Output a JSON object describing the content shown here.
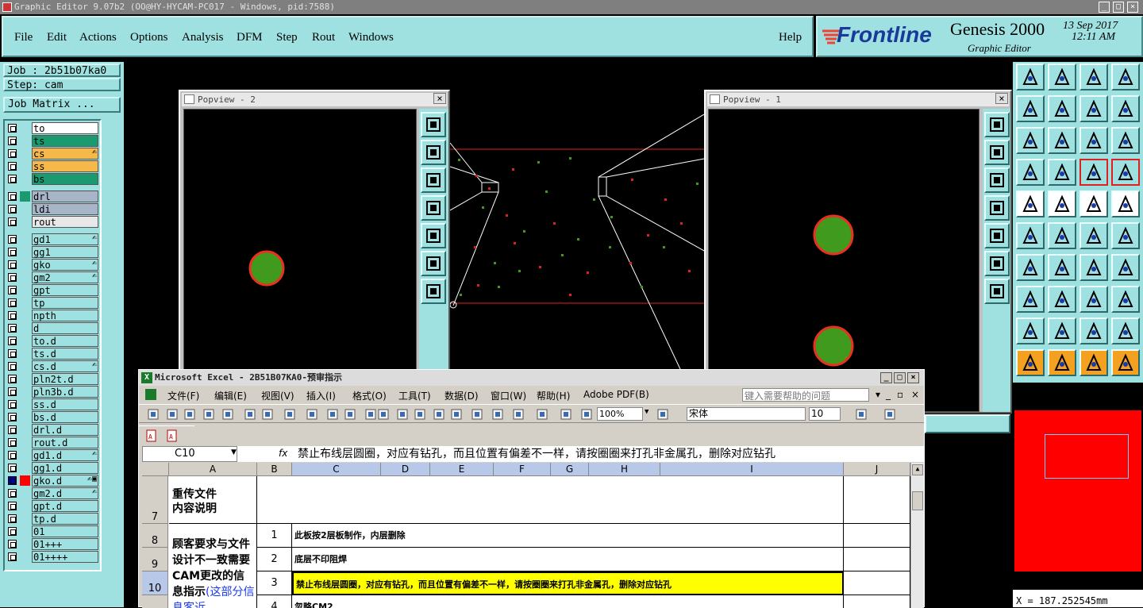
{
  "window": {
    "title": "Graphic Editor 9.07b2 (OO@HY-HYCAM-PC017 - Windows, pid:7588)"
  },
  "menu": [
    "File",
    "Edit",
    "Actions",
    "Options",
    "Analysis",
    "DFM",
    "Step",
    "Rout",
    "Windows"
  ],
  "help_label": "Help",
  "logo": {
    "brand": "Frontline",
    "product": "Genesis 2000",
    "subtitle": "Graphic Editor",
    "date": "13 Sep 2017",
    "time": "12:11 AM"
  },
  "job": {
    "job_label": "Job : 2b51b07ka0",
    "step_label": "Step: cam",
    "matrix_button": "Job Matrix ..."
  },
  "layers": [
    {
      "name": "to",
      "bg": "#ffffff",
      "mark": ""
    },
    {
      "name": "ts",
      "bg": "#1a9a6e",
      "mark": ""
    },
    {
      "name": "cs",
      "bg": "#f7b84a",
      "mark": "✍"
    },
    {
      "name": "ss",
      "bg": "#f7b84a",
      "mark": ""
    },
    {
      "name": "bs",
      "bg": "#1a9a6e",
      "mark": ""
    },
    {
      "name": "drl",
      "bg": "#a8b4c8",
      "mark": ""
    },
    {
      "name": "ldi",
      "bg": "#a8b4c8",
      "mark": ""
    },
    {
      "name": "rout",
      "bg": "#e8e8e8",
      "mark": ""
    },
    {
      "name": "gd1",
      "bg": "#9fe1e1",
      "mark": "✍"
    },
    {
      "name": "gg1",
      "bg": "#9fe1e1",
      "mark": ""
    },
    {
      "name": "gko",
      "bg": "#9fe1e1",
      "mark": "✍"
    },
    {
      "name": "gm2",
      "bg": "#9fe1e1",
      "mark": "✍"
    },
    {
      "name": "gpt",
      "bg": "#9fe1e1",
      "mark": ""
    },
    {
      "name": "tp",
      "bg": "#9fe1e1",
      "mark": ""
    },
    {
      "name": "npth",
      "bg": "#9fe1e1",
      "mark": ""
    },
    {
      "name": "d",
      "bg": "#9fe1e1",
      "mark": ""
    },
    {
      "name": "to.d",
      "bg": "#9fe1e1",
      "mark": ""
    },
    {
      "name": "ts.d",
      "bg": "#9fe1e1",
      "mark": ""
    },
    {
      "name": "cs.d",
      "bg": "#9fe1e1",
      "mark": "✍"
    },
    {
      "name": "pln2t.d",
      "bg": "#9fe1e1",
      "mark": ""
    },
    {
      "name": "pln3b.d",
      "bg": "#9fe1e1",
      "mark": ""
    },
    {
      "name": "ss.d",
      "bg": "#9fe1e1",
      "mark": ""
    },
    {
      "name": "bs.d",
      "bg": "#9fe1e1",
      "mark": ""
    },
    {
      "name": "drl.d",
      "bg": "#9fe1e1",
      "mark": ""
    },
    {
      "name": "rout.d",
      "bg": "#9fe1e1",
      "mark": ""
    },
    {
      "name": "gd1.d",
      "bg": "#9fe1e1",
      "mark": "✍"
    },
    {
      "name": "gg1.d",
      "bg": "#9fe1e1",
      "mark": ""
    },
    {
      "name": "gko.d",
      "bg": "#9fe1e1",
      "mark": "✍▣"
    },
    {
      "name": "gm2.d",
      "bg": "#9fe1e1",
      "mark": "✍"
    },
    {
      "name": "gpt.d",
      "bg": "#9fe1e1",
      "mark": ""
    },
    {
      "name": "tp.d",
      "bg": "#9fe1e1",
      "mark": ""
    },
    {
      "name": "01",
      "bg": "#9fe1e1",
      "mark": ""
    },
    {
      "name": "01+++",
      "bg": "#9fe1e1",
      "mark": ""
    },
    {
      "name": "01++++",
      "bg": "#9fe1e1",
      "mark": ""
    }
  ],
  "popview2": {
    "title": "Popview - 2"
  },
  "popview1": {
    "title": "Popview - 1"
  },
  "coords": "X = 187.252545mm",
  "excel": {
    "title": "Microsoft Excel - 2B51B07KA0-预审指示",
    "menu": [
      "文件(F)",
      "编辑(E)",
      "视图(V)",
      "插入(I)",
      "格式(O)",
      "工具(T)",
      "数据(D)",
      "窗口(W)",
      "帮助(H)",
      "Adobe PDF(B)"
    ],
    "help_placeholder": "键入需要帮助的问题",
    "zoom": "100%",
    "font": "宋体",
    "font_size": "10",
    "name_box": "C10",
    "fx": "fx",
    "formula": "禁止布线层圆圈，对应有钻孔，而且位置有偏差不一样，请按圈圈来打孔非金属孔，删除对应钻孔",
    "columns": [
      "A",
      "B",
      "C",
      "D",
      "E",
      "F",
      "G",
      "H",
      "I",
      "J"
    ],
    "rows": [
      {
        "num": "7",
        "a": "重传文件\n内容说明",
        "b": "",
        "c": ""
      },
      {
        "num": "8",
        "b": "1",
        "c": "此板按2层板制作，内层删除"
      },
      {
        "num": "9",
        "b": "2",
        "c": "底层不印阻焊"
      },
      {
        "num": "10",
        "b": "3",
        "c": "禁止布线层圆圈，对应有钻孔，而且位置有偏差不一样，请按圈圈来打孔非金属孔，删除对应钻孔"
      },
      {
        "num": "",
        "b": "4",
        "c": "忽略CM2"
      }
    ],
    "merged_a": "顾客要求与文件设计不一致需要CAM更改的信息指示",
    "merged_a_blue": "(这部分信息客近"
  }
}
